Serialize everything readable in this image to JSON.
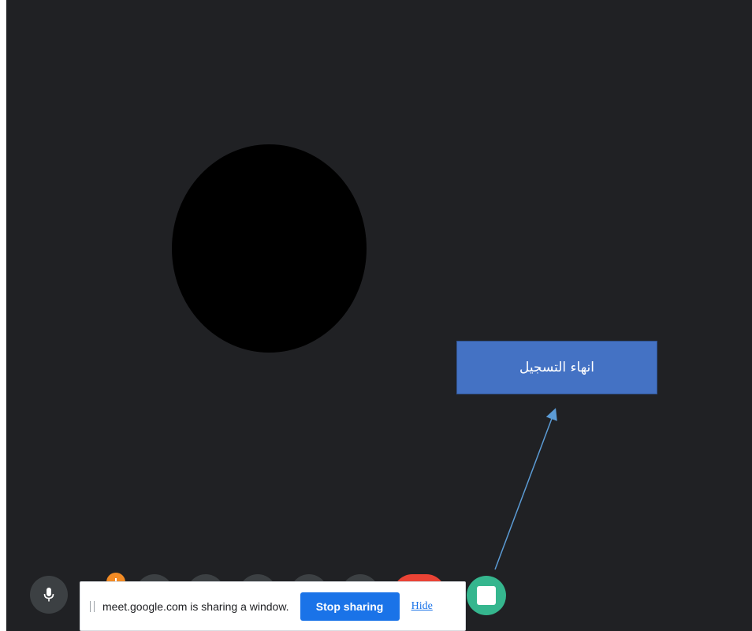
{
  "callout": {
    "label": "انهاء التسجيل",
    "background_color": "#4472c4"
  },
  "screen_share_bar": {
    "message": "meet.google.com is sharing a window.",
    "stop_label": "Stop sharing",
    "hide_label": "Hide"
  },
  "controls": {
    "mic_icon": "microphone-icon",
    "record_icon": "stop-recording-icon",
    "end_call_color": "#ea4335",
    "record_color": "#35b68e"
  },
  "colors": {
    "background": "#202124",
    "arrow": "#5b9bd5",
    "badge": "#f28b25"
  }
}
